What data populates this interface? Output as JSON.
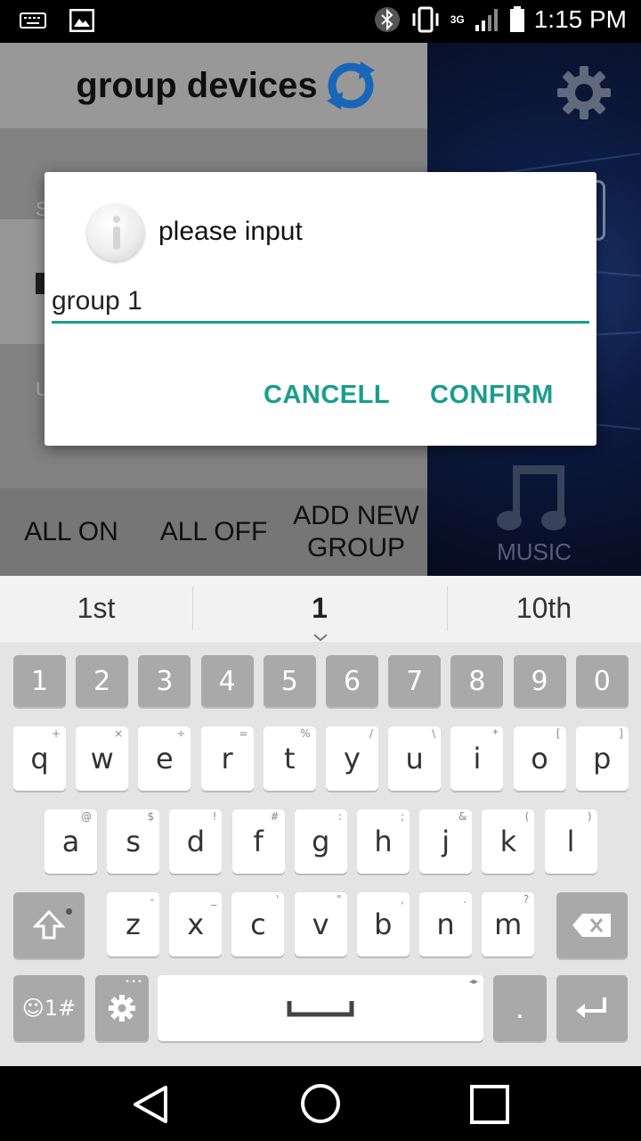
{
  "status_bar": {
    "time": "1:15 PM",
    "network": "3G"
  },
  "app": {
    "title": "group devices",
    "left_row_letter_1": "S",
    "left_row_letter_2": "U",
    "bottom_buttons": {
      "all_on": "ALL ON",
      "all_off": "ALL OFF",
      "add_new_group_line1": "ADD NEW",
      "add_new_group_line2": "GROUP"
    },
    "music_label": "MUSIC"
  },
  "dialog": {
    "title": "please input",
    "input_value": "group 1",
    "cancel_label": "CANCELL",
    "confirm_label": "CONFIRM",
    "accent_color": "#199d8e"
  },
  "suggestions": [
    "1st",
    "1",
    "10th"
  ],
  "keyboard": {
    "number_row": [
      "1",
      "2",
      "3",
      "4",
      "5",
      "6",
      "7",
      "8",
      "9",
      "0"
    ],
    "row1": [
      {
        "k": "q",
        "h": "+"
      },
      {
        "k": "w",
        "h": "×"
      },
      {
        "k": "e",
        "h": "÷"
      },
      {
        "k": "r",
        "h": "="
      },
      {
        "k": "t",
        "h": "%"
      },
      {
        "k": "y",
        "h": "/"
      },
      {
        "k": "u",
        "h": "\\"
      },
      {
        "k": "i",
        "h": "*"
      },
      {
        "k": "o",
        "h": "["
      },
      {
        "k": "p",
        "h": "]"
      }
    ],
    "row2": [
      {
        "k": "a",
        "h": "@"
      },
      {
        "k": "s",
        "h": "$"
      },
      {
        "k": "d",
        "h": "!"
      },
      {
        "k": "f",
        "h": "#"
      },
      {
        "k": "g",
        "h": ":"
      },
      {
        "k": "h",
        "h": ";"
      },
      {
        "k": "j",
        "h": "&"
      },
      {
        "k": "k",
        "h": "("
      },
      {
        "k": "l",
        "h": ")"
      }
    ],
    "row3": [
      {
        "k": "z",
        "h": "-"
      },
      {
        "k": "x",
        "h": "_"
      },
      {
        "k": "c",
        "h": "'"
      },
      {
        "k": "v",
        "h": "\""
      },
      {
        "k": "b",
        "h": ","
      },
      {
        "k": "n",
        "h": "."
      },
      {
        "k": "m",
        "h": "?"
      }
    ],
    "symbols_label": "☺1#",
    "period_label": "."
  }
}
